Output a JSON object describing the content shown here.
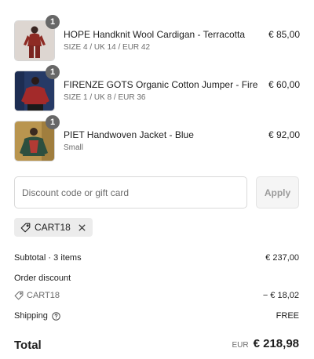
{
  "line_items": [
    {
      "quantity": "1",
      "name": "HOPE Handknit Wool Cardigan - Terracotta",
      "variant": "SIZE 4 / UK 14 / EUR 42",
      "price": "€ 85,00",
      "image_colors": {
        "bg": "#ddd6d1",
        "garment": "#8e2b24"
      }
    },
    {
      "quantity": "1",
      "name": "FIRENZE GOTS Organic Cotton Jumper - Fire",
      "variant": "SIZE 1 / UK 8 / EUR 36",
      "price": "€ 60,00",
      "image_colors": {
        "bg": "#263a66",
        "garment": "#a32a2a"
      }
    },
    {
      "quantity": "1",
      "name": "PIET Handwoven Jacket - Blue",
      "variant": "Small",
      "price": "€ 92,00",
      "image_colors": {
        "bg": "#b9954f",
        "garment": "#2c4f3f"
      }
    }
  ],
  "discount": {
    "placeholder": "Discount code or gift card",
    "value": "",
    "apply_label": "Apply"
  },
  "applied_code": {
    "code": "CART18"
  },
  "summary": {
    "subtotal_label": "Subtotal · 3 items",
    "subtotal_value": "€ 237,00",
    "order_discount_label": "Order discount",
    "discount_code": "CART18",
    "discount_value": "− € 18,02",
    "shipping_label": "Shipping",
    "shipping_value": "FREE",
    "total_label": "Total",
    "total_currency": "EUR",
    "total_value": "€ 218,98"
  },
  "colors": {
    "badge": "#676767",
    "text": "#1f1f1f",
    "muted": "#6b6b6b",
    "apply_text": "#9b9b9b",
    "tag_bg": "#ececec"
  }
}
